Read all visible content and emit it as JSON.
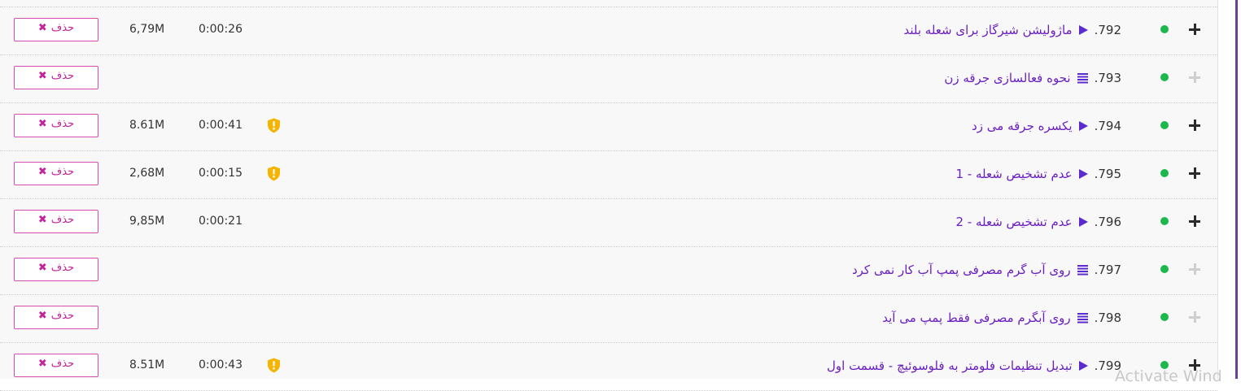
{
  "delete_label": "حذف",
  "watermark": "Activate Wind",
  "colors": {
    "title": "#6a1fc0",
    "status_dot": "#1cb84b",
    "delete_border": "#d64bb0",
    "delete_text": "#c2249b",
    "shield": "#f5b400"
  },
  "rows": [
    {
      "number": ".792",
      "type_icon": "play-icon",
      "title": "ماژولیشن شیرگاز برای شعله بلند",
      "duration": "0:00:26",
      "size": "6,79M",
      "has_shield": false,
      "expand_active": true
    },
    {
      "number": ".793",
      "type_icon": "list-icon",
      "title": "نحوه فعالسازی جرقه زن",
      "duration": "",
      "size": "",
      "has_shield": false,
      "expand_active": false
    },
    {
      "number": ".794",
      "type_icon": "play-icon",
      "title": "یکسره جرقه می زد",
      "duration": "0:00:41",
      "size": "8.61M",
      "has_shield": true,
      "expand_active": true
    },
    {
      "number": ".795",
      "type_icon": "play-icon",
      "title": "عدم تشخیص شعله - 1",
      "duration": "0:00:15",
      "size": "2,68M",
      "has_shield": true,
      "expand_active": true
    },
    {
      "number": ".796",
      "type_icon": "play-icon",
      "title": "عدم تشخیص شعله - 2",
      "duration": "0:00:21",
      "size": "9,85M",
      "has_shield": false,
      "expand_active": true
    },
    {
      "number": ".797",
      "type_icon": "list-icon",
      "title": "روی آب گرم مصرفی پمپ آب کار نمی کرد",
      "duration": "",
      "size": "",
      "has_shield": false,
      "expand_active": false
    },
    {
      "number": ".798",
      "type_icon": "list-icon",
      "title": "روی آبگرم مصرفی فقط پمپ می آید",
      "duration": "",
      "size": "",
      "has_shield": false,
      "expand_active": false
    },
    {
      "number": ".799",
      "type_icon": "play-icon",
      "title": "تبدیل تنظیمات فلومتر به فلوسوئیچ - قسمت اول",
      "duration": "0:00:43",
      "size": "8.51M",
      "has_shield": true,
      "expand_active": true
    }
  ]
}
